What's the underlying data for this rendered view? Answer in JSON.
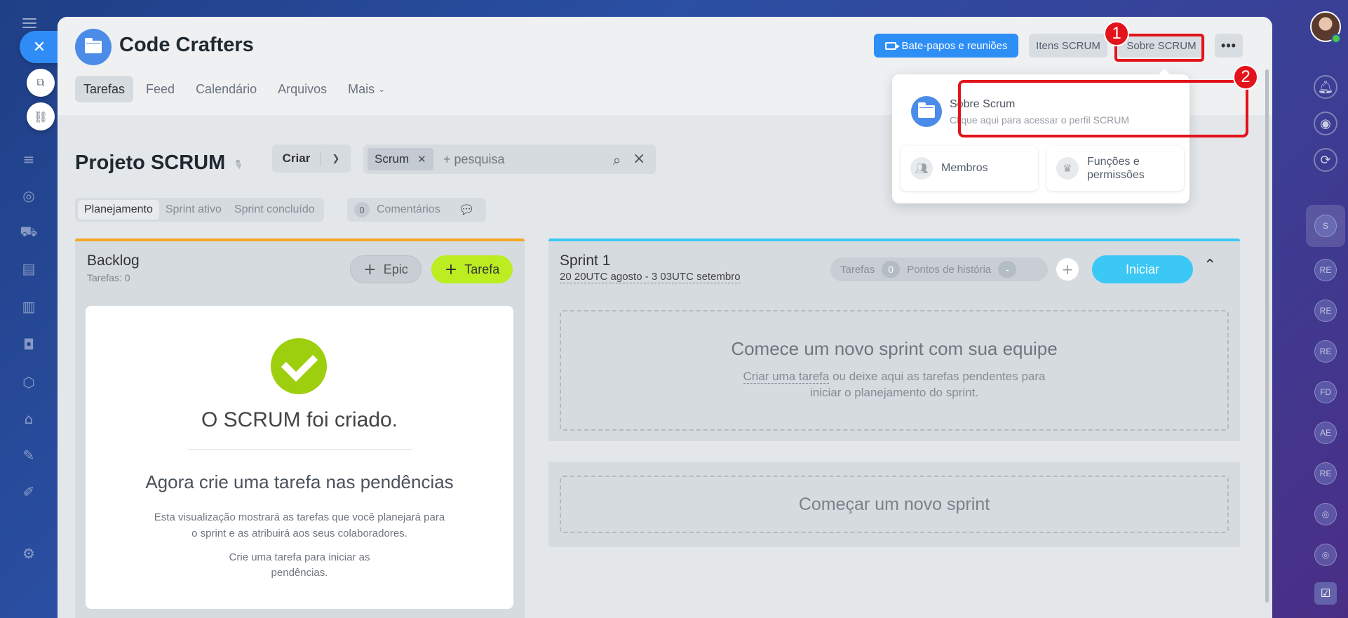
{
  "left_rail": {
    "close_symbol": "✕"
  },
  "header": {
    "project_name": "Code Crafters",
    "buttons": {
      "chats": "Bate-papos e reuniões",
      "items": "Itens SCRUM",
      "about": "Sobre SCRUM",
      "more": "•••"
    },
    "tabs": [
      {
        "label": "Tarefas",
        "active": true
      },
      {
        "label": "Feed"
      },
      {
        "label": "Calendário"
      },
      {
        "label": "Arquivos"
      },
      {
        "label": "Mais"
      }
    ]
  },
  "annotations": {
    "step1": "1",
    "step2": "2",
    "color": "#e3131b"
  },
  "toolbar": {
    "page_title": "Projeto SCRUM",
    "create_label": "Criar",
    "filter_chip": "Scrum",
    "search_placeholder": "+ pesquisa",
    "subtabs": [
      "Planejamento",
      "Sprint ativo",
      "Sprint concluído"
    ],
    "comments_count": "0",
    "comments_label": "Comentários"
  },
  "backlog": {
    "title": "Backlog",
    "tasks_count_label": "Tarefas: 0",
    "epic_label": "Epic",
    "task_label": "Tarefa",
    "accent_color": "#f5a623",
    "empty_state": {
      "title": "O SCRUM foi criado.",
      "subtitle": "Agora crie uma tarefa nas pendências",
      "description": "Esta visualização mostrará as tarefas que você planejará para o sprint e as atribuirá aos seus colaboradores.",
      "hint": "Crie uma tarefa para iniciar as pendências."
    }
  },
  "sprint": {
    "title": "Sprint 1",
    "dates": "20 20UTC agosto - 3 03UTC setembro",
    "tasks_label": "Tarefas",
    "tasks_value": "0",
    "story_points_label": "Pontos de história",
    "story_points_value": "-",
    "start_label": "Iniciar",
    "accent_color": "#3bc8f5",
    "dropzone_title": "Comece um novo sprint com sua equipe",
    "dropzone_link": "Criar uma tarefa",
    "dropzone_text": " ou deixe aqui as tarefas pendentes para iniciar o planejamento do sprint.",
    "new_sprint_label": "Começar um novo sprint"
  },
  "popup": {
    "about_title": "Sobre Scrum",
    "about_subtitle": "Clique aqui para acessar o perfil SCRUM",
    "members_label": "Membros",
    "roles_label": "Funções e permissões"
  },
  "right_rail": {
    "chats": [
      "S",
      "RE",
      "RE",
      "RE",
      "FD",
      "AE",
      "RE"
    ]
  }
}
